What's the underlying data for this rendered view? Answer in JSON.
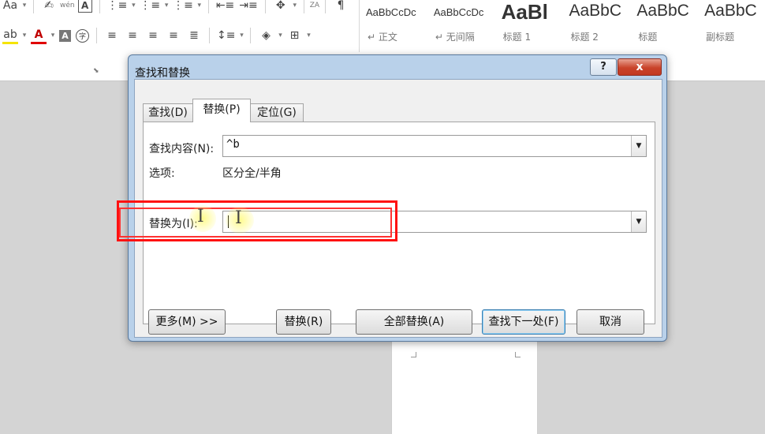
{
  "ribbon": {
    "row1": [
      "Aa",
      "▾",
      "✍",
      "wén",
      "A",
      "⋮≡",
      "▾",
      "⋮≡",
      "▾",
      "⋮≡",
      "▾",
      "⇤≡",
      "⇥≡",
      "✥",
      "▾",
      "ZA",
      "¶"
    ],
    "row2": [
      "ab",
      "▾",
      "A",
      "▾",
      "A",
      "字",
      "≡",
      "≡",
      "≡",
      "≡",
      "≣",
      "↕≡",
      "▾",
      "◈",
      "▾",
      "⊞",
      "▾"
    ],
    "styles": [
      {
        "sample": "AaBbCcDc",
        "label": "↵ 正文"
      },
      {
        "sample": "AaBbCcDc",
        "label": "↵ 无间隔"
      },
      {
        "sample": "AaBl",
        "label": "标题 1"
      },
      {
        "sample": "AaBbC",
        "label": "标题 2"
      },
      {
        "sample": "AaBbC",
        "label": "标题"
      },
      {
        "sample": "AaBbC",
        "label": "副标题"
      }
    ]
  },
  "dialog": {
    "title": "查找和替换",
    "help_label": "?",
    "close_label": "x",
    "tabs": {
      "find": "查找(D)",
      "replace": "替换(P)",
      "goto": "定位(G)"
    },
    "find_label": "查找内容(N):",
    "find_value": "^b",
    "options_label": "选项:",
    "options_value": "区分全/半角",
    "replace_label": "替换为(I):",
    "replace_value": "",
    "combo_arrow": "▼",
    "buttons": {
      "more": "更多(M) >>",
      "replace": "替换(R)",
      "replace_all": "全部替换(A)",
      "find_next": "查找下一处(F)",
      "cancel": "取消"
    }
  },
  "colors": {
    "dialog_frame": "#b9d1ea",
    "highlight": "#ff1111",
    "close_button": "#c9432a",
    "cursor_glow": "#fffa78"
  }
}
